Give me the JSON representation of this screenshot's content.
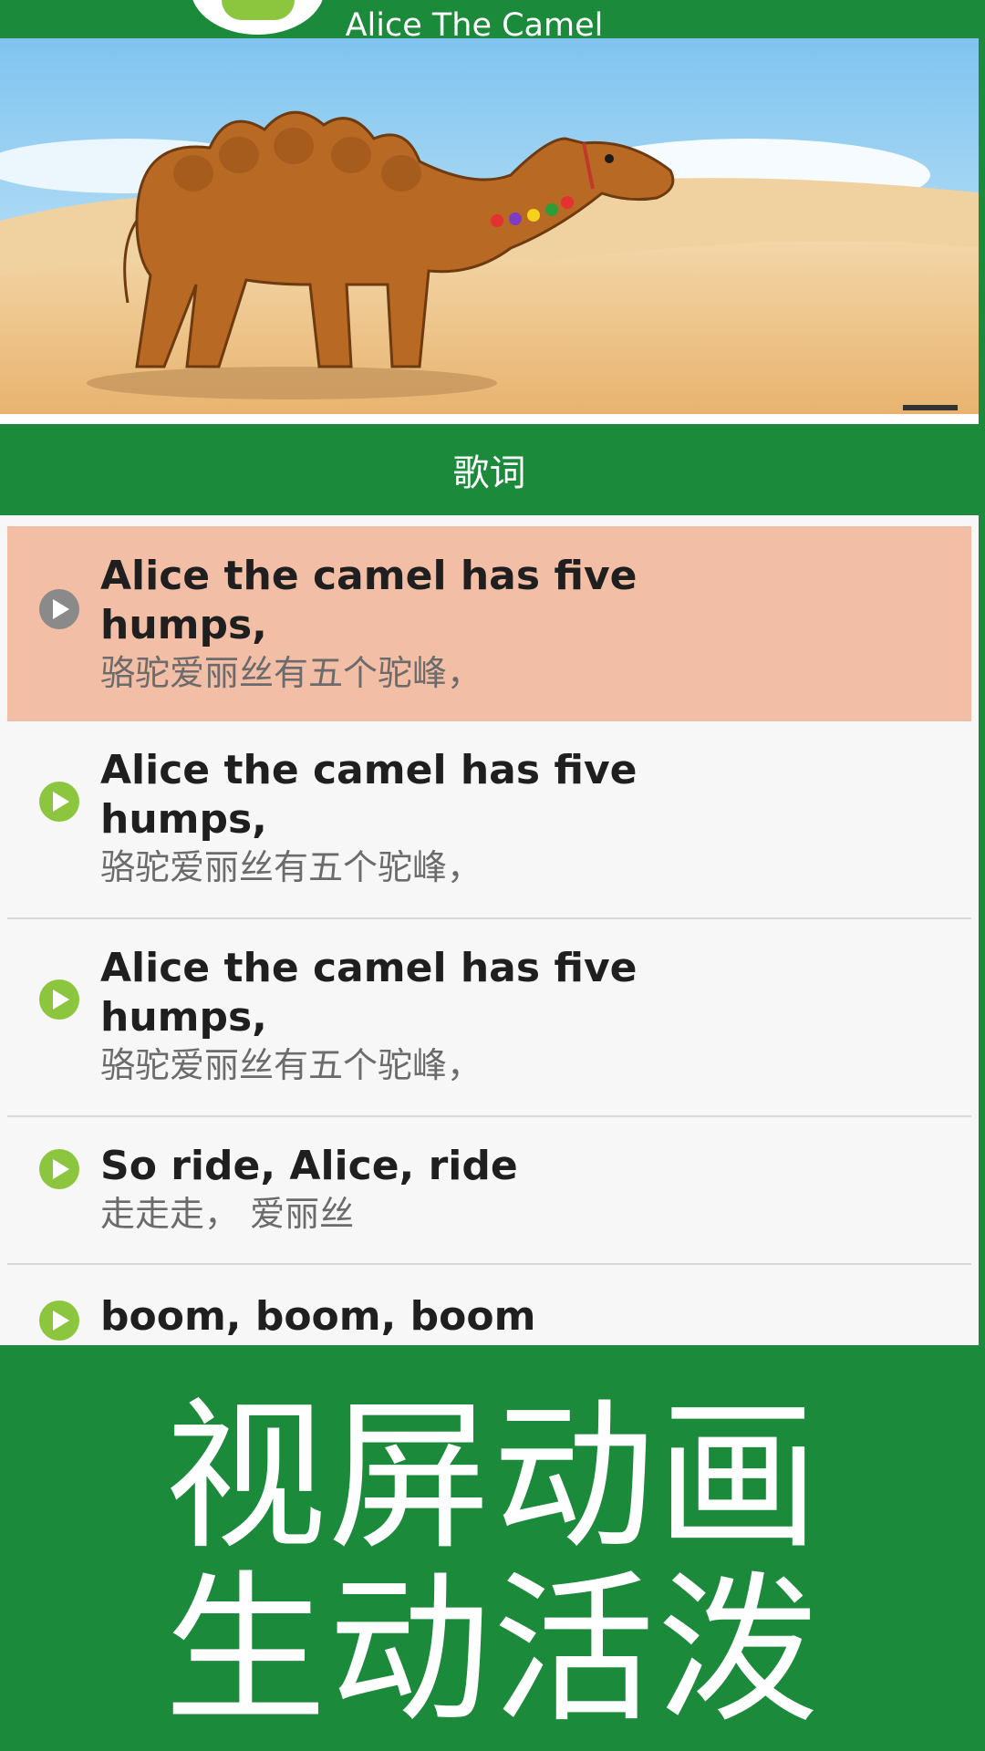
{
  "header": {
    "title": "Alice The Camel"
  },
  "lyrics_section": {
    "title": "歌词"
  },
  "lyrics": [
    {
      "en": "Alice the camel has five humps,",
      "zh": "骆驼爱丽丝有五个驼峰，",
      "state": "playing"
    },
    {
      "en": "Alice the camel has five humps,",
      "zh": "骆驼爱丽丝有五个驼峰，",
      "state": "idle"
    },
    {
      "en": "Alice the camel has five humps,",
      "zh": "骆驼爱丽丝有五个驼峰，",
      "state": "idle"
    },
    {
      "en": "So ride, Alice, ride",
      "zh": "走走走，  爱丽丝",
      "state": "idle"
    },
    {
      "en": "boom, boom, boom",
      "zh": "",
      "state": "idle"
    }
  ],
  "promo": {
    "line1": "视屏动画",
    "line2": "生动活泼"
  },
  "colors": {
    "primary_green": "#1b8a3a",
    "active_row": "#f3bea6",
    "play_icon_green": "#8cc63f",
    "play_icon_gray": "#8a8a8a"
  }
}
